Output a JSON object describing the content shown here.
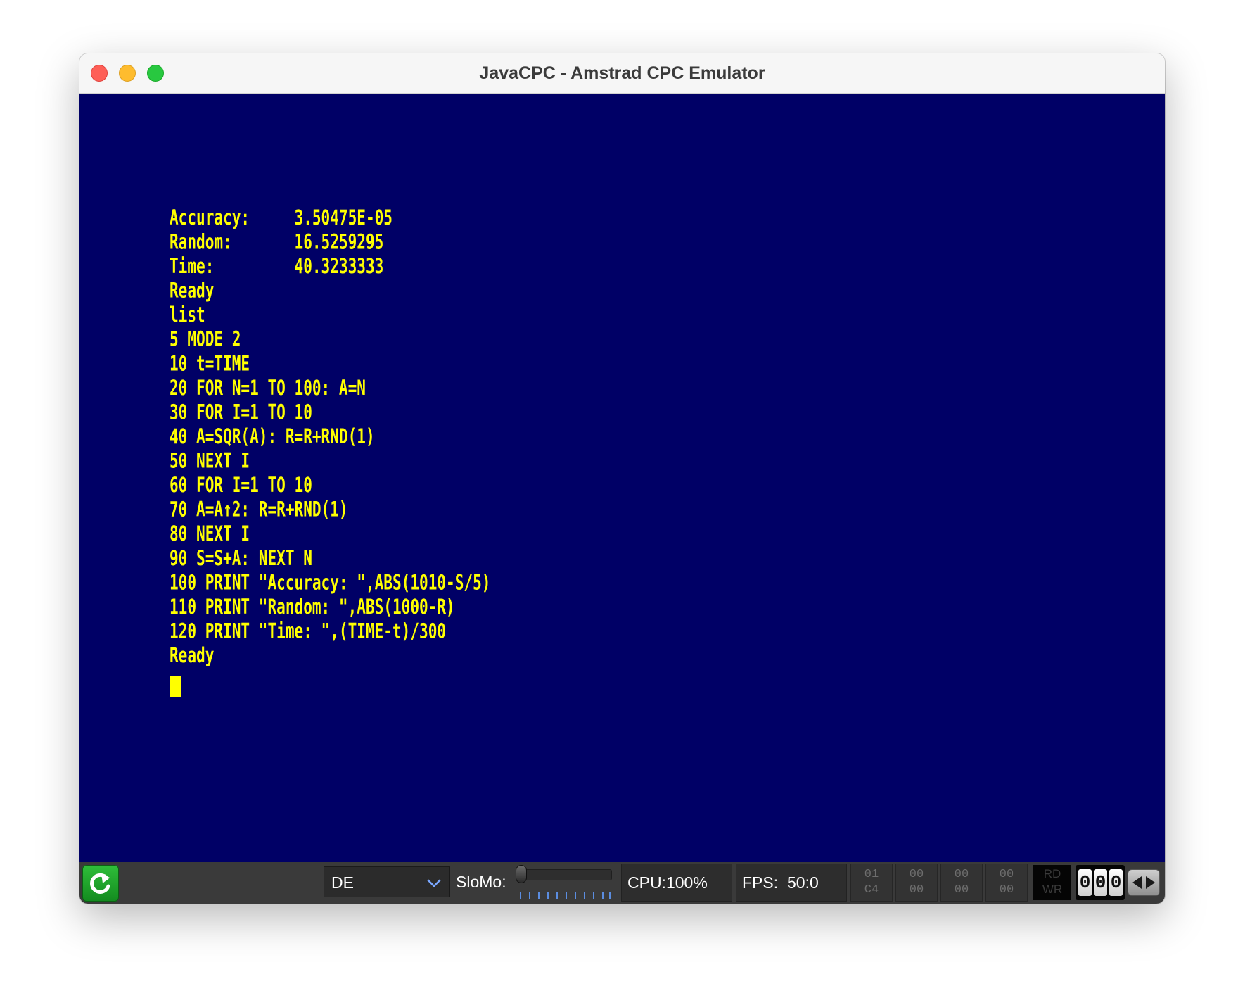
{
  "window": {
    "title": "JavaCPC - Amstrad CPC Emulator"
  },
  "terminal": {
    "lines": [
      "Accuracy:     3.50475E-05",
      "Random:       16.5259295",
      "Time:         40.3233333",
      "Ready",
      "list",
      "5 MODE 2",
      "10 t=TIME",
      "20 FOR N=1 TO 100: A=N",
      "30 FOR I=1 TO 10",
      "40 A=SQR(A): R=R+RND(1)",
      "50 NEXT I",
      "60 FOR I=1 TO 10",
      "70 A=A↑2: R=R+RND(1)",
      "80 NEXT I",
      "90 S=S+A: NEXT N",
      "100 PRINT \"Accuracy: \",ABS(1010-S/5)",
      "110 PRINT \"Random: \",ABS(1000-R)",
      "120 PRINT \"Time: \",(TIME-t)/300",
      "Ready"
    ]
  },
  "statusbar": {
    "keyboard_layout": "DE",
    "slomo_label": "SloMo:",
    "slomo_level": 0,
    "cpu": "CPU:100%",
    "fps_label": "FPS:",
    "fps_value": "50:0",
    "hex_cells": [
      {
        "top": "01",
        "bottom": "C4"
      },
      {
        "top": "00",
        "bottom": "00"
      },
      {
        "top": "00",
        "bottom": "00"
      },
      {
        "top": "00",
        "bottom": "00"
      }
    ],
    "rd_label": "RD",
    "wr_label": "WR",
    "tape_counter": [
      "0",
      "0",
      "0"
    ]
  },
  "colors": {
    "screen_bg": "#000066",
    "text": "#ffff00",
    "statusbar_bg": "#3a3a3a"
  },
  "icons": {
    "reset": "reset-arrow-icon",
    "dropdown": "chevron-down-icon",
    "tape": "tape-direction-icon"
  }
}
